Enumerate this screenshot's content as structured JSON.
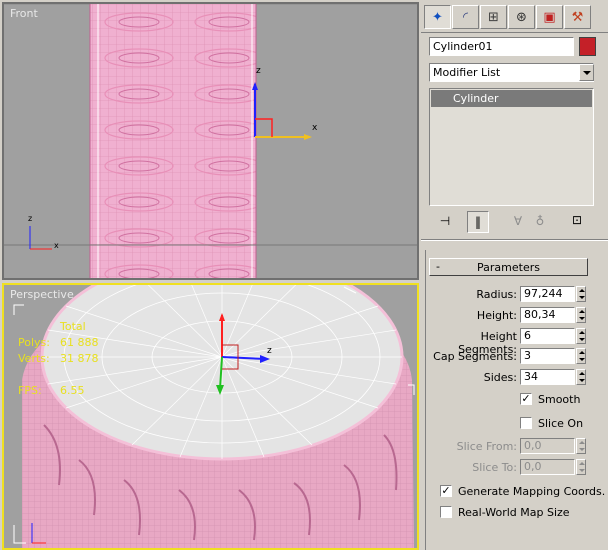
{
  "viewports": {
    "front": {
      "label": "Front"
    },
    "perspective": {
      "label": "Perspective",
      "stats": {
        "total_header": "Total",
        "polys_label": "Polys:",
        "polys_value": "61 888",
        "verts_label": "Verts:",
        "verts_value": "31 878",
        "fps_label": "FPS:",
        "fps_value": "6.55"
      }
    }
  },
  "gizmo": {
    "x": "x",
    "y": "y",
    "z": "z"
  },
  "command_panel": {
    "tabs": [
      {
        "icon": "create-icon"
      },
      {
        "icon": "modify-icon"
      },
      {
        "icon": "hierarchy-icon"
      },
      {
        "icon": "motion-icon"
      },
      {
        "icon": "display-icon"
      },
      {
        "icon": "utilities-icon"
      }
    ],
    "object_name": "Cylinder01",
    "object_color": "#c42028",
    "modifier_list": "Modifier List",
    "stack": [
      "Cylinder"
    ],
    "parameters": {
      "title": "Parameters",
      "collapse_symbol": "-",
      "radius_label": "Radius:",
      "radius_value": "97,244",
      "height_label": "Height:",
      "height_value": "80,34",
      "height_segments_label": "Height Segments:",
      "height_segments_value": "6",
      "cap_segments_label": "Cap Segments:",
      "cap_segments_value": "3",
      "sides_label": "Sides:",
      "sides_value": "34",
      "smooth_label": "Smooth",
      "smooth_checked": "✓",
      "slice_on_label": "Slice On",
      "slice_from_label": "Slice From:",
      "slice_from_value": "0,0",
      "slice_to_label": "Slice To:",
      "slice_to_value": "0,0",
      "gen_mapping_label": "Generate Mapping Coords.",
      "gen_mapping_checked": "✓",
      "real_world_label": "Real-World Map Size"
    }
  },
  "colors": {
    "viewport_bg": "#a0a0a0",
    "mesh": "#f0a8c8",
    "active_border": "#f0e020",
    "accent_x": "#ff2020",
    "accent_y": "#20c020",
    "accent_z": "#2020ff"
  }
}
